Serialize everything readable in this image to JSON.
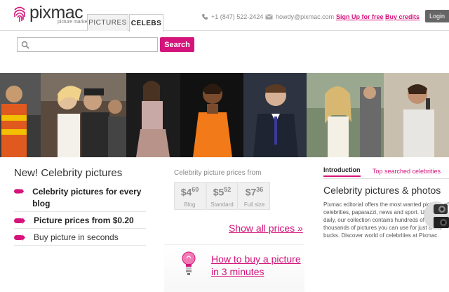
{
  "header": {
    "logo_name": "pixmac",
    "logo_tag": "picture market",
    "tabs": [
      {
        "label": "PICTURES"
      },
      {
        "label": "CELEBS"
      }
    ],
    "phone": "+1 (847) 522-2424",
    "email": "howdy@pixmac.com",
    "signup_label": "Sign Up for free",
    "buycredits_label": "Buy credits",
    "login_label": "Login"
  },
  "search": {
    "placeholder": "",
    "button_label": "Search"
  },
  "left": {
    "title": "New! Celebrity pictures",
    "features": [
      {
        "text": "Celebrity pictures for every blog"
      },
      {
        "text": "Picture prices from $0.20"
      },
      {
        "text": "Buy picture in seconds"
      }
    ]
  },
  "prices": {
    "title": "Celebrity picture prices from",
    "items": [
      {
        "currency": "$",
        "whole": "4",
        "cents": "60",
        "label": "Blog"
      },
      {
        "currency": "$",
        "whole": "5",
        "cents": "52",
        "label": "Standard"
      },
      {
        "currency": "$",
        "whole": "7",
        "cents": "36",
        "label": "Full size"
      }
    ],
    "show_all": "Show all prices »",
    "howto": "How to buy a picture in 3 minutes"
  },
  "right": {
    "tabs": [
      {
        "label": "Introduction"
      },
      {
        "label": "Top searched celebrities"
      }
    ],
    "title": "Celebrity pictures & photos",
    "text": "Pixmac editorial offers the most wanted pictures of celebrities, paparazzi, news and sport. Updated daily, our collection contains hundreds of thousands of pictures you can use for just a few bucks. Discover world of celebrities at Pixmac."
  },
  "colors": {
    "accent": "#d4147b",
    "login_bg": "#666666"
  }
}
